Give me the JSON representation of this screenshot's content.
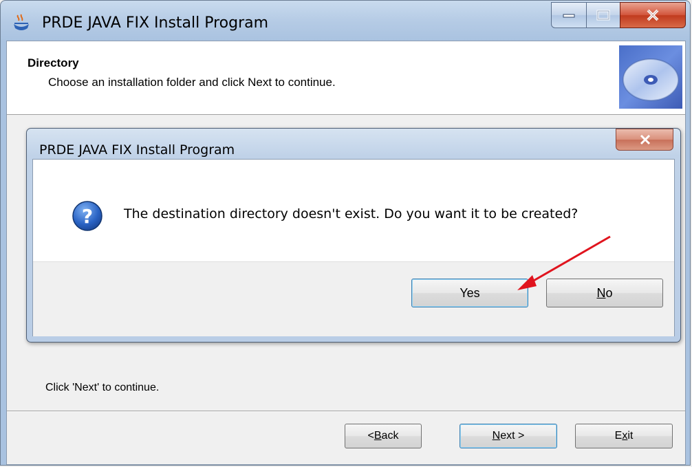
{
  "window": {
    "title": "PRDE JAVA FIX Install Program"
  },
  "header": {
    "title": "Directory",
    "subtitle": "Choose an installation folder and click Next to continue."
  },
  "dialog": {
    "title": "PRDE JAVA FIX Install Program",
    "message": "The destination directory doesn't exist. Do you want it to be created?",
    "yes_label": "Yes",
    "no_label_mnemonic": "N",
    "no_label_rest": "o"
  },
  "footer": {
    "hint": "Click 'Next' to continue.",
    "back_prefix": "< ",
    "back_mnemonic": "B",
    "back_rest": "ack",
    "next_mnemonic": "N",
    "next_rest": "ext >",
    "exit_start": "E",
    "exit_mnemonic": "x",
    "exit_rest": "it"
  },
  "colors": {
    "annotation_arrow": "#e0141e"
  },
  "icons": {
    "title": "java-coffee-cup-icon",
    "header": "cd-disc-icon",
    "dialog": "question-icon"
  }
}
